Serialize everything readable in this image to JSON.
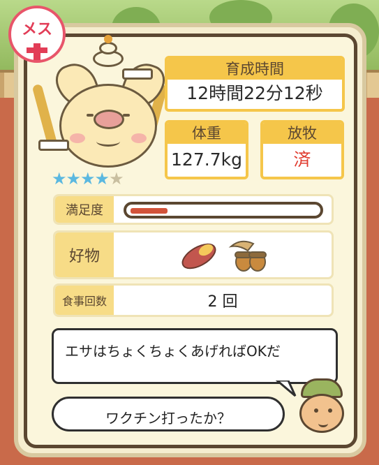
{
  "gender_badge": {
    "label": "メス",
    "color": "#e23d57"
  },
  "stats": {
    "growth_time": {
      "label": "育成時間",
      "value": "12時間22分12秒"
    },
    "weight": {
      "label": "体重",
      "value": "127.7kg"
    },
    "grazing": {
      "label": "放牧",
      "value": "済",
      "value_color": "#e03b2e"
    }
  },
  "rating": {
    "stars_filled": 4,
    "stars_total": 5
  },
  "satisfaction": {
    "label": "満足度",
    "level_fraction": 0.2
  },
  "favorites": {
    "label": "好物",
    "items": [
      "sweet-potato-icon",
      "acorn-icon"
    ]
  },
  "meal_count": {
    "label": "食事回数",
    "value": "2 回"
  },
  "dialogue": {
    "line1": "エサはちょくちょくあげればOKだ",
    "line2": "ワクチン打ったか？"
  },
  "colors": {
    "accent": "#f5c64a",
    "star": "#5bb8e0",
    "bar": "#d2533a"
  }
}
